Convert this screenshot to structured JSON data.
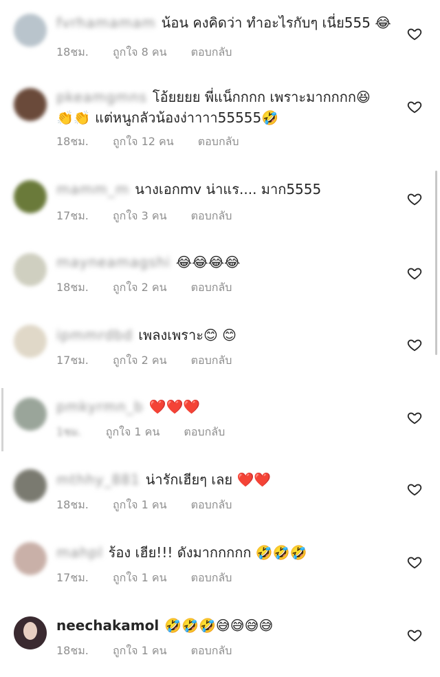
{
  "comments": [
    {
      "username": "fvrhamamam",
      "text": "น้อน คงคิดว่า ทำอะไรกับๆ เนี่ย555 😂",
      "time": "18ชม.",
      "likes": "ถูกใจ 8 คน",
      "reply": "ตอบกลับ",
      "avatar_color": "#b9c4cc"
    },
    {
      "username": "pkeamgmns",
      "text": "โอ้ยยยย พี่แน็กกกก เพราะมากกกก😆",
      "text2": "👏👏 แต่หนูกลัวน้องง่าาาา55555🤣",
      "time": "18ชม.",
      "likes": "ถูกใจ 12 คน",
      "reply": "ตอบกลับ",
      "avatar_color": "#6a4a3a"
    },
    {
      "username": "mamm_m",
      "text": "นางเอกmv  น่าแร.... มาก5555",
      "time": "17ชม.",
      "likes": "ถูกใจ 3 คน",
      "reply": "ตอบกลับ",
      "avatar_color": "#6a7a3a"
    },
    {
      "username": "mayneamagshi",
      "text": "😂😂😂😂",
      "time": "18ชม.",
      "likes": "ถูกใจ 2 คน",
      "reply": "ตอบกลับ",
      "avatar_color": "#cfcfc0"
    },
    {
      "username": "ipmmrdbd",
      "text": "เพลงเพราะ😊 😊",
      "time": "17ชม.",
      "likes": "ถูกใจ 2 คน",
      "reply": "ตอบกลับ",
      "avatar_color": "#e0d8c8"
    },
    {
      "username": "pmkyrmn_b",
      "text": "❤️❤️❤️",
      "time": "1ชม.",
      "likes": "ถูกใจ 1 คน",
      "reply": "ตอบกลับ",
      "avatar_color": "#9aa59a"
    },
    {
      "username": "mthhy_881",
      "text": "น่ารักเฮียๆ เลย ❤️❤️",
      "time": "18ชม.",
      "likes": "ถูกใจ 1 คน",
      "reply": "ตอบกลับ",
      "avatar_color": "#7a7a70"
    },
    {
      "username": "mahpl",
      "text": "ร้อง เฮีย!!! ดังมากกกกก 🤣🤣🤣",
      "time": "17ชม.",
      "likes": "ถูกใจ 1 คน",
      "reply": "ตอบกลับ",
      "avatar_color": "#c9b0a8"
    },
    {
      "username": "neechakamol",
      "text": "🤣🤣🤣😅😅😅😅",
      "time": "18ชม.",
      "likes": "ถูกใจ 1 คน",
      "reply": "ตอบกลับ",
      "avatar_color": "#3a2a30"
    }
  ]
}
